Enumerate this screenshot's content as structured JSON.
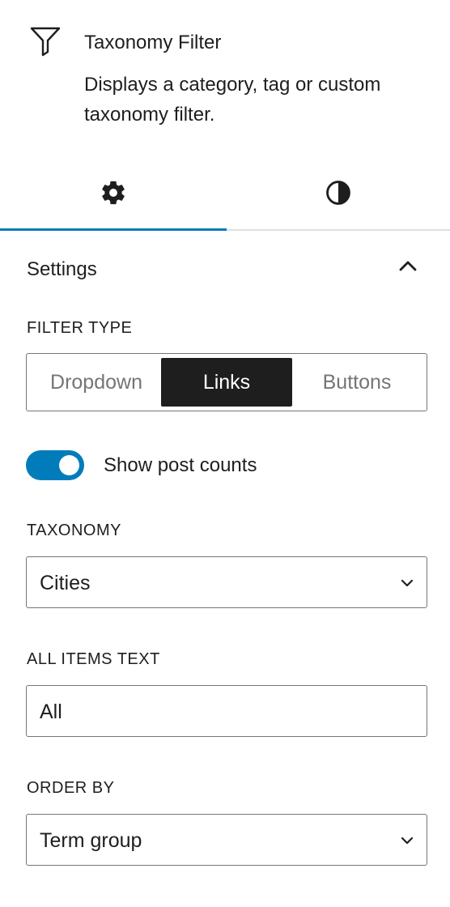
{
  "block": {
    "icon": "filter-icon",
    "title": "Taxonomy Filter",
    "description": "Displays a category, tag or custom taxonomy filter."
  },
  "tabs": [
    {
      "icon": "gear-icon",
      "active": true
    },
    {
      "icon": "contrast-icon",
      "active": false
    }
  ],
  "panel": {
    "title": "Settings",
    "toggle_icon": "chevron-up-icon"
  },
  "filter_type": {
    "label": "FILTER TYPE",
    "options": [
      "Dropdown",
      "Links",
      "Buttons"
    ],
    "selected": "Links"
  },
  "show_post_counts": {
    "label": "Show post counts",
    "checked": true
  },
  "taxonomy": {
    "label": "TAXONOMY",
    "value": "Cities"
  },
  "all_items_text": {
    "label": "ALL ITEMS TEXT",
    "value": "All"
  },
  "order_by": {
    "label": "ORDER BY",
    "value": "Term group"
  },
  "colors": {
    "accent": "#007cba",
    "text": "#1e1e1e",
    "border": "#757575",
    "selected_segment": "#1e1e1e"
  }
}
